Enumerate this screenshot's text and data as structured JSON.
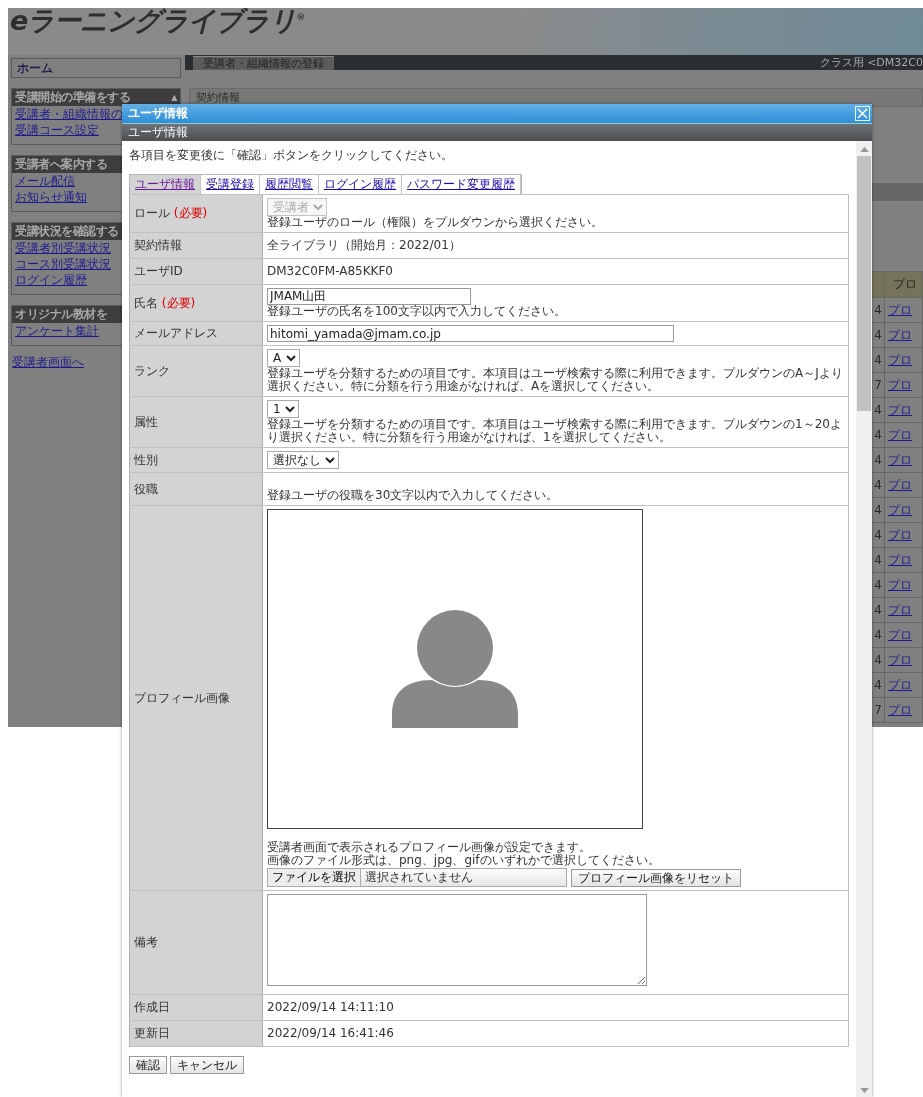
{
  "background_page": {
    "logo": "eラーニングライブラリ$^{®}$",
    "home": "ホーム",
    "sidebar_sections": [
      {
        "title": "受講開始の準備をする",
        "toggle": "▲",
        "links": [
          "受講者・組織情報の",
          "受講コース設定"
        ]
      },
      {
        "title": "受講者へ案内する",
        "links": [
          "メール配信",
          "お知らせ通知"
        ]
      },
      {
        "title": "受講状況を確認する",
        "links": [
          "受講者別受講状況",
          "コース別受講状況",
          "ログイン履歴"
        ]
      },
      {
        "title": "オリジナル教材を",
        "links": [
          "アンケート集計"
        ]
      }
    ],
    "footer_link": "受講者画面へ",
    "page_tab": "受講者・組織情報の登録",
    "class_label": "クラス用 <DM32C0",
    "section_bar": "契約情報",
    "table": {
      "header": "プロ",
      "rows": [
        {
          "column_1": "4",
          "column_2": "プロ"
        },
        {
          "column_1": "4",
          "column_2": "プロ"
        },
        {
          "column_1": "4",
          "column_2": "プロ"
        },
        {
          "column_1": "7",
          "column_2": "プロ"
        },
        {
          "column_1": "4",
          "column_2": "プロ"
        },
        {
          "column_1": "4",
          "column_2": "プロ"
        },
        {
          "column_1": "4",
          "column_2": "プロ"
        },
        {
          "column_1": "4",
          "column_2": "プロ"
        },
        {
          "column_1": "4",
          "column_2": "プロ"
        },
        {
          "column_1": "4",
          "column_2": "プロ"
        },
        {
          "column_1": "4",
          "column_2": "プロ"
        },
        {
          "column_1": "4",
          "column_2": "プロ"
        },
        {
          "column_1": "4",
          "column_2": "プロ"
        },
        {
          "column_1": "4",
          "column_2": "プロ"
        },
        {
          "column_1": "4",
          "column_2": "プロ"
        },
        {
          "column_1": "4",
          "column_2": "プロ"
        },
        {
          "column_1": "7",
          "column_2": "プロ"
        }
      ]
    }
  },
  "dialog": {
    "title": "ユーザ情報",
    "subtitle": "ユーザ情報",
    "instruction": "各項目を変更後に「確認」ボタンをクリックしてください。",
    "tabs": [
      {
        "label": "ユーザ情報",
        "selected": true
      },
      {
        "label": "受講登録",
        "selected": false
      },
      {
        "label": "履歴閲覧",
        "selected": false
      },
      {
        "label": "ログイン履歴",
        "selected": false
      },
      {
        "label": "パスワード変更履歴",
        "selected": false
      }
    ],
    "rows": [
      {
        "label": "ロール",
        "required_mark": "(必要)",
        "kind": "select",
        "value": "受講者",
        "disabled": true,
        "hint": "登録ユーザのロール（権限）をプルダウンから選択ください。"
      },
      {
        "label": "契約情報",
        "kind": "text",
        "value": "全ライブラリ（開始月：2022/01）"
      },
      {
        "label": "ユーザID",
        "kind": "text",
        "value": "DM32C0FM-A85KKF0"
      },
      {
        "label": "氏名",
        "required_mark": "(必要)",
        "kind": "input",
        "value": "JMAM山田",
        "hint": "登録ユーザの氏名を100文字以内で入力してください。"
      },
      {
        "label": "メールアドレス",
        "kind": "email",
        "value": "hitomi_yamada@jmam.co.jp"
      },
      {
        "label": "ランク",
        "kind": "select",
        "value": "A",
        "disabled": false,
        "hint": "登録ユーザを分類するための項目です。本項目はユーザ検索する際に利用できます。プルダウンのA～Jより選択ください。特に分類を行う用途がなければ、Aを選択してください。"
      },
      {
        "label": "属性",
        "kind": "select",
        "value": "1",
        "disabled": false,
        "hint": "登録ユーザを分類するための項目です。本項目はユーザ検索する際に利用できます。プルダウンの1～20より選択ください。特に分類を行う用途がなければ、1を選択してください。"
      },
      {
        "label": "性別",
        "kind": "select",
        "value": "選択なし",
        "disabled": false
      },
      {
        "label": "役職",
        "kind": "hint",
        "hint": "登録ユーザの役職を30文字以内で入力してください。"
      },
      {
        "label": "プロフィール画像",
        "kind": "image",
        "hint_lines": [
          "受講者画面で表示されるプロフィール画像が設定できます。",
          "画像のファイル形式は、png、jpg、gifのいずれかで選択してください。"
        ],
        "file_button": "ファイルを選択",
        "file_status": "選択されていません",
        "reset_button": "プロフィール画像をリセット"
      },
      {
        "label": "備考",
        "kind": "textarea"
      },
      {
        "label": "作成日",
        "kind": "text",
        "value": "2022/09/14 14:11:10"
      },
      {
        "label": "更新日",
        "kind": "text",
        "value": "2022/09/14 16:41:46"
      }
    ],
    "buttons": [
      "確認",
      "キャンセル"
    ]
  }
}
